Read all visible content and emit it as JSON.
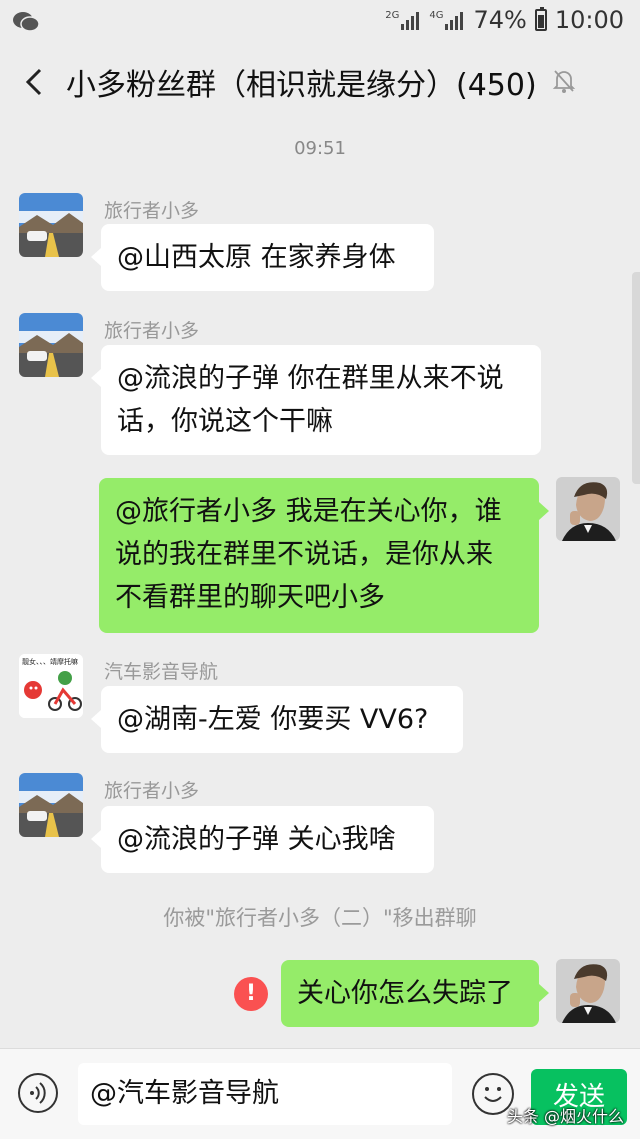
{
  "status_bar": {
    "battery": "74%",
    "time": "10:00",
    "net1": "2G",
    "net2": "4G"
  },
  "header": {
    "title": "小多粉丝群（相识就是缘分）(450)"
  },
  "time_separator": "09:51",
  "messages": [
    {
      "sender": "旅行者小多",
      "text": "@山西太原  在家养身体"
    },
    {
      "sender": "旅行者小多",
      "line1": "@流浪的子弹  你在群里从来不说",
      "line2": "话，你说这个干嘛"
    },
    {
      "line1": "@旅行者小多  我是在关心你，谁",
      "line2": "说的我在群里不说话，是你从来",
      "line3": "不看群里的聊天吧小多"
    },
    {
      "sender": "汽车影音导航",
      "text": "@湖南-左爱  你要买 VV6?"
    },
    {
      "sender": "旅行者小多",
      "text": "@流浪的子弹  关心我啥"
    },
    {
      "text": "关心你怎么失踪了",
      "failed_mark": "!"
    }
  ],
  "avatar_caption": "靓女、、、靖摩托嘛",
  "system_notice": "你被\"旅行者小多（二）\"移出群聊",
  "input": {
    "value": "@汽车影音导航",
    "send_label": "发送"
  },
  "watermark": "头条 @烟火什么",
  "colors": {
    "outgoing_bubble": "#95ec69",
    "send_button": "#07c160",
    "error": "#fa5151"
  }
}
